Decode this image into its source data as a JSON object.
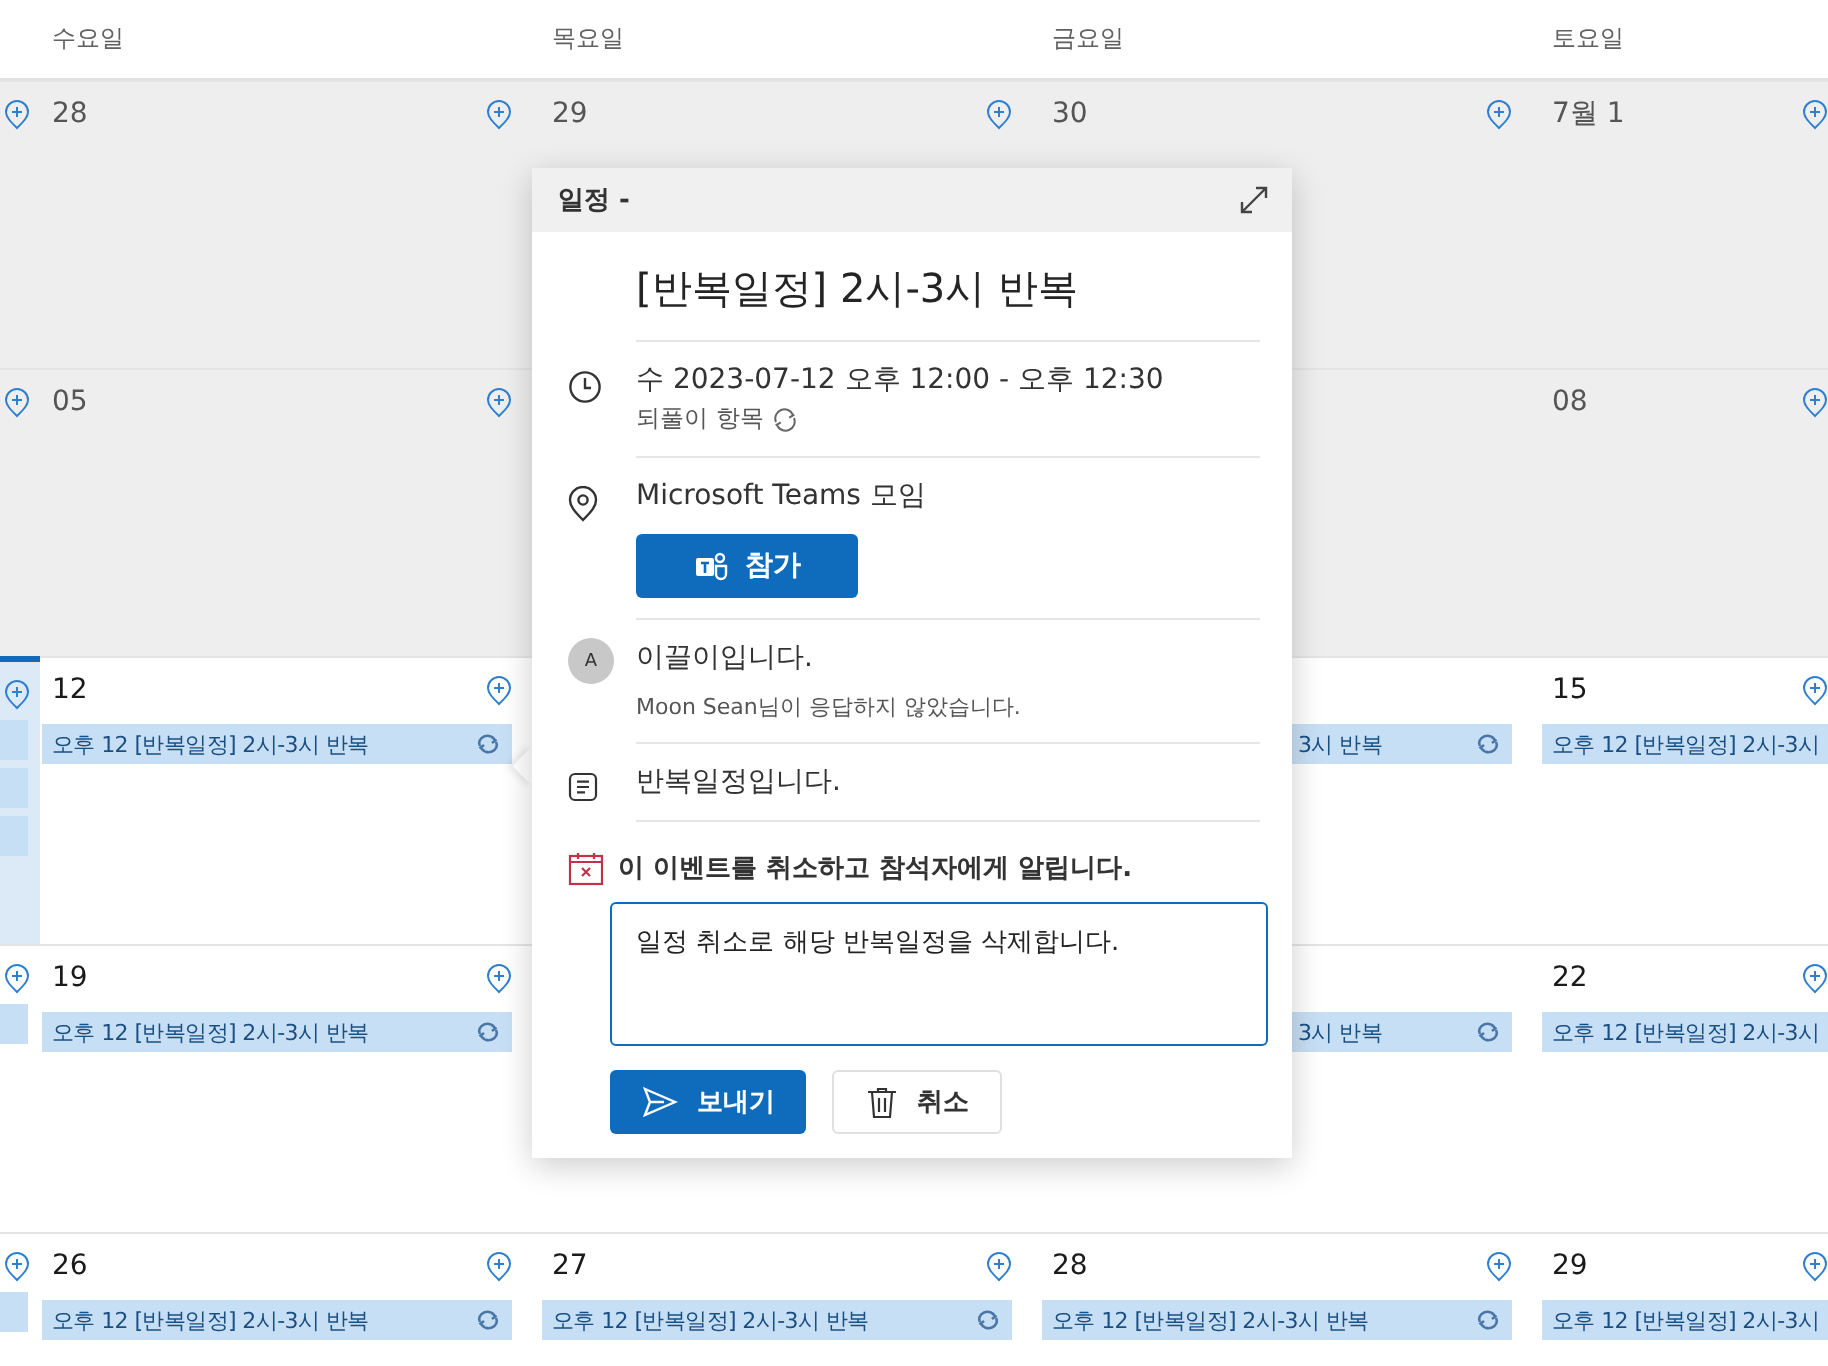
{
  "day_headers": [
    "수요일",
    "목요일",
    "금요일",
    "토요일"
  ],
  "weeks": [
    {
      "cells": [
        {
          "past": true
        },
        {
          "date": "28",
          "past": true
        },
        {
          "date": "29",
          "past": true
        },
        {
          "date": "30",
          "past": true
        },
        {
          "date": "7월 1",
          "past": true
        }
      ]
    },
    {
      "cells": [
        {
          "past": true
        },
        {
          "date": "05",
          "past": true
        },
        {},
        {
          "past": true
        },
        {
          "date": "08",
          "past": true
        }
      ]
    },
    {
      "cells": [
        {
          "today": true,
          "past": false,
          "events": [
            {
              "kind": "stub"
            },
            {
              "kind": "stub"
            },
            {
              "kind": "stub"
            }
          ]
        },
        {
          "date": "12",
          "past": false,
          "events": [
            {
              "kind": "full",
              "time": "오후 12",
              "title": "[반복일정] 2시-3시 반복",
              "recurring": true
            }
          ]
        },
        {},
        {
          "past": false,
          "events": [
            {
              "kind": "covered",
              "title": "3시 반복",
              "recurring": true
            }
          ]
        },
        {
          "date": "15",
          "past": false,
          "events": [
            {
              "kind": "full",
              "time": "오후 12",
              "title": "[반복일정] 2시-3시",
              "recurring": false
            }
          ]
        }
      ]
    },
    {
      "cells": [
        {
          "past": false,
          "events": [
            {
              "kind": "stub"
            }
          ]
        },
        {
          "date": "19",
          "past": false,
          "events": [
            {
              "kind": "full",
              "time": "오후 12",
              "title": "[반복일정] 2시-3시 반복",
              "recurring": true
            }
          ]
        },
        {},
        {
          "past": false,
          "events": [
            {
              "kind": "covered",
              "title": "3시 반복",
              "recurring": true
            }
          ]
        },
        {
          "date": "22",
          "past": false,
          "events": [
            {
              "kind": "full",
              "time": "오후 12",
              "title": "[반복일정] 2시-3시",
              "recurring": false
            }
          ]
        }
      ]
    },
    {
      "cells": [
        {
          "past": false,
          "events": [
            {
              "kind": "stub"
            }
          ]
        },
        {
          "date": "26",
          "past": false,
          "events": [
            {
              "kind": "full",
              "time": "오후 12",
              "title": "[반복일정] 2시-3시 반복",
              "recurring": true
            }
          ]
        },
        {
          "date": "27",
          "past": false,
          "events": [
            {
              "kind": "full",
              "time": "오후 12",
              "title": "[반복일정] 2시-3시 반복",
              "recurring": true
            }
          ]
        },
        {
          "date": "28",
          "past": false,
          "events": [
            {
              "kind": "full",
              "time": "오후 12",
              "title": "[반복일정] 2시-3시 반복",
              "recurring": true
            }
          ]
        },
        {
          "date": "29",
          "past": false,
          "events": [
            {
              "kind": "full",
              "time": "오후 12",
              "title": "[반복일정] 2시-3시",
              "recurring": false
            }
          ]
        }
      ]
    }
  ],
  "popup": {
    "header": "일정 -",
    "title": "[반복일정] 2시-3시 반복",
    "datetime": "수 2023-07-12 오후 12:00 - 오후 12:30",
    "recurrence": "되풀이 항목",
    "location": "Microsoft Teams 모임",
    "join_button": "참가",
    "organizer": {
      "initial": "A",
      "note": "이끌이입니다.",
      "response": "Moon Sean님이 응답하지 않았습니다."
    },
    "description": "반복일정입니다.",
    "cancel_notice": "이 이벤트를 취소하고 참석자에게 알립니다.",
    "message": "일정 취소로 해당 반복일정을 삭제합니다.",
    "send_button": "보내기",
    "discard_button": "취소"
  }
}
